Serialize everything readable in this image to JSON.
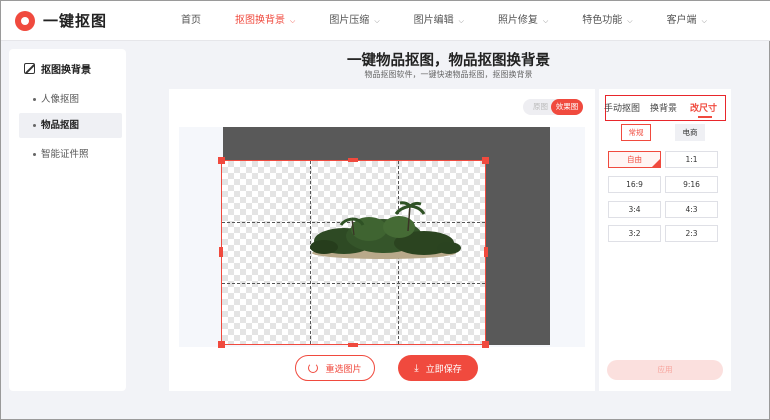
{
  "header": {
    "logo_text": "一键抠图",
    "nav": [
      {
        "label": "首页",
        "has_menu": false,
        "active": false
      },
      {
        "label": "抠图换背景",
        "has_menu": true,
        "active": true
      },
      {
        "label": "图片压缩",
        "has_menu": true,
        "active": false
      },
      {
        "label": "图片编辑",
        "has_menu": true,
        "active": false
      },
      {
        "label": "照片修复",
        "has_menu": true,
        "active": false
      },
      {
        "label": "特色功能",
        "has_menu": true,
        "active": false
      },
      {
        "label": "客户端",
        "has_menu": true,
        "active": false
      }
    ]
  },
  "sidebar": {
    "heading": "抠图换背景",
    "items": [
      {
        "label": "人像抠图",
        "active": false
      },
      {
        "label": "物品抠图",
        "active": true
      },
      {
        "label": "智能证件照",
        "active": false
      }
    ]
  },
  "page": {
    "title": "一键物品抠图，物品抠图换背景",
    "subtitle": "物品抠图软件，一键快速物品抠图，抠图换背景"
  },
  "viewer": {
    "toggle_original": "原图",
    "toggle_effect": "效果图",
    "reselect_label": "重选图片",
    "save_label": "立即保存"
  },
  "right_panel": {
    "tabs": [
      {
        "label": "手动抠图",
        "active": false
      },
      {
        "label": "换背景",
        "active": false
      },
      {
        "label": "改尺寸",
        "active": true
      }
    ],
    "subtabs": [
      {
        "label": "常规",
        "active": true
      },
      {
        "label": "电商",
        "active": false
      }
    ],
    "ratios": [
      {
        "label": "自由",
        "active": true
      },
      {
        "label": "1:1",
        "active": false
      },
      {
        "label": "16:9",
        "active": false
      },
      {
        "label": "9:16",
        "active": false
      },
      {
        "label": "3:4",
        "active": false
      },
      {
        "label": "4:3",
        "active": false
      },
      {
        "label": "3:2",
        "active": false
      },
      {
        "label": "2:3",
        "active": false
      }
    ],
    "apply_label": "应用"
  },
  "colors": {
    "accent": "#f04a3e",
    "page_bg": "#f2f3f7",
    "highlight_box": "#e8262b"
  }
}
